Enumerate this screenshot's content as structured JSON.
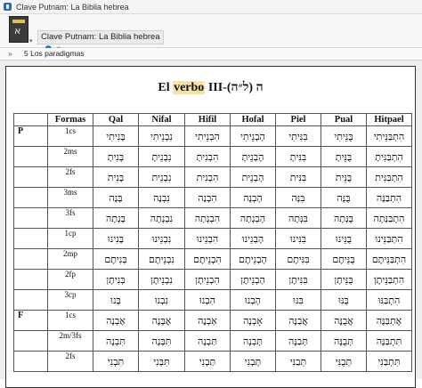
{
  "window": {
    "title": "Clave Putnam: La Biblia hebrea"
  },
  "tab": {
    "title": "Clave Putnam: La Biblia hebrea"
  },
  "breadcrumb": {
    "chevron": "»",
    "label": "5 Los paradigmas"
  },
  "heading": {
    "before": "El ",
    "highlight": "verbo",
    "after": " III-ה (ל״ה)"
  },
  "table": {
    "columns": [
      "",
      "Formas",
      "Qal",
      "Nifal",
      "Hifil",
      "Hofal",
      "Piel",
      "Pual",
      "Hitpael"
    ],
    "rows": [
      {
        "group": "P",
        "form": "1cs",
        "cells": [
          "בָּנִיתִי",
          "נִבְנֵיתִי",
          "הִבְנֵיתִי",
          "הָבְנֵיתִי",
          "בִּנִּיתִי",
          "בֻּנֵּיתִי",
          "הִתְבַּנֵּיתִי"
        ]
      },
      {
        "group": "",
        "form": "2ms",
        "cells": [
          "בָּנִיתָ",
          "נִבְנֵיתָ",
          "הִבְנִיתָ",
          "הָבְנֵיתָ",
          "בִּנִּיתָ",
          "בֻּנֵּיתָ",
          "הִתְבַּנִּיתָ"
        ]
      },
      {
        "group": "",
        "form": "2fs",
        "cells": [
          "בָּנִית",
          "נִבְנֵית",
          "הִבְנִית",
          "הָבְנֵית",
          "בִּנִּית",
          "בֻּנֵּית",
          "הִתְבַּנִּית"
        ]
      },
      {
        "group": "",
        "form": "3ms",
        "cells": [
          "בָּנָה",
          "נִבְנָה",
          "הִבְנָה",
          "הָבְנָה",
          "בִּנָּה",
          "בֻּנָּה",
          "הִתְבַּנָּה"
        ]
      },
      {
        "group": "",
        "form": "3fs",
        "cells": [
          "בָּנְתָה",
          "נִבְנְתָה",
          "הִבְנְתָה",
          "הָבְנְתָה",
          "בִּנְּתָה",
          "בֻּנְּתָה",
          "הִתְבַּנְּתָה"
        ]
      },
      {
        "group": "",
        "form": "1cp",
        "cells": [
          "בָּנִינוּ",
          "נִבְנֵינוּ",
          "הִבְנֵינוּ",
          "הָבְנֵינוּ",
          "בִּנִּינוּ",
          "בֻּנֵּינוּ",
          "הִתְבַּנֵּינוּ"
        ]
      },
      {
        "group": "",
        "form": "2mp",
        "cells": [
          "בְּנִיתֶם",
          "נִבְנֵיתֶם",
          "הִבְנֵיתֶם",
          "הָבְנֵיתֶם",
          "בִּנִּיתֶם",
          "בֻּנֵּיתֶם",
          "הִתְבַּנֵּיתֶם"
        ]
      },
      {
        "group": "",
        "form": "2fp",
        "cells": [
          "בְּנִיתֶן",
          "נִבְנֵיתֶן",
          "הִבְנֵיתֶן",
          "הָבְנֵיתֶן",
          "בִּנִּיתֶן",
          "בֻּנֵּיתֶן",
          "הִתְבַּנֵּיתֶן"
        ]
      },
      {
        "group": "",
        "form": "3cp",
        "cells": [
          "בָּנוּ",
          "נִבְנוּ",
          "הִבְנוּ",
          "הָבְנוּ",
          "בִּנּוּ",
          "בֻּנּוּ",
          "הִתְבַּנּוּ"
        ]
      },
      {
        "group": "F",
        "form": "1cs",
        "cells": [
          "אֶבְנֶה",
          "אֶבָּנֶה",
          "אַבְנֶה",
          "אָבְנֶה",
          "אֲבַנֶּה",
          "אֲבֻנֶּה",
          "אֶתְבַּנֶּה"
        ]
      },
      {
        "group": "",
        "form": "2m/3fs",
        "cells": [
          "תִּבְנֶה",
          "תִּבָּנֶה",
          "תַּבְנֶה",
          "תָּבְנֶה",
          "תְּבַנֶּה",
          "תְּבֻנֶּה",
          "תִּתְבַּנֶּה"
        ]
      },
      {
        "group": "",
        "form": "2fs",
        "cells": [
          "תִּבְנִי",
          "תִּבָּנִי",
          "תַּבְנִי",
          "תָּבְנִי",
          "תְּבַנִּי",
          "תְּבֻנִּי",
          "תִּתְבַּנִּי"
        ]
      }
    ]
  }
}
